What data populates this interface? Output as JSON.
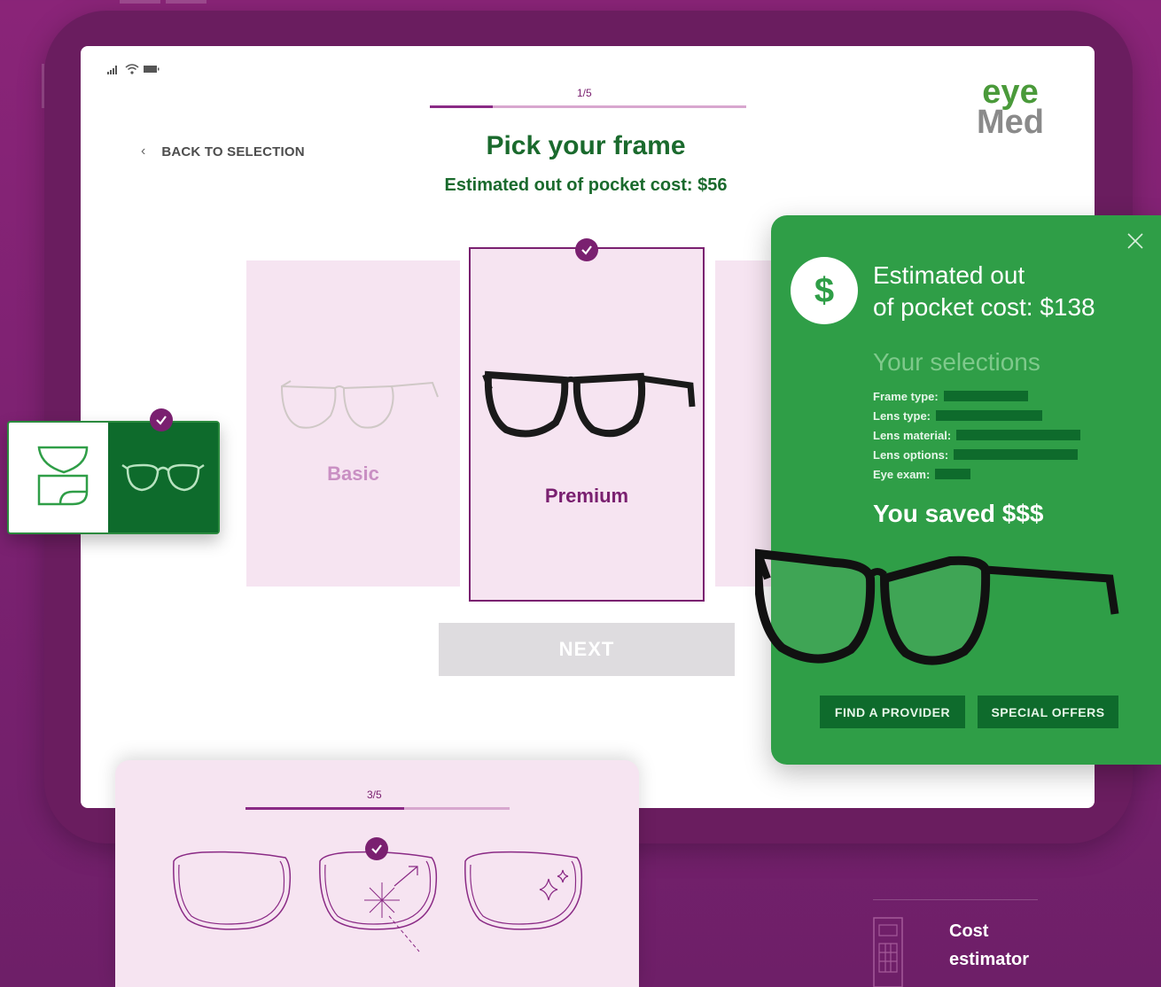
{
  "screen": {
    "progress": {
      "label": "1/5",
      "fraction": 0.2
    },
    "logo": {
      "line1": "eye",
      "line2": "Med"
    },
    "back_label": "BACK TO SELECTION",
    "title": "Pick your frame",
    "subtitle": "Estimated out of pocket cost: $56",
    "frames": [
      {
        "label": "Basic",
        "selected": false
      },
      {
        "label": "Premium",
        "selected": true
      }
    ],
    "next_label": "NEXT"
  },
  "cost_panel": {
    "heading_line1": "Estimated out",
    "heading_line2": "of pocket cost: $138",
    "currency_symbol": "$",
    "selections_title": "Your selections",
    "selections": [
      {
        "label": "Frame type:"
      },
      {
        "label": "Lens type:"
      },
      {
        "label": "Lens material:"
      },
      {
        "label": "Lens options:"
      },
      {
        "label": "Eye exam:"
      }
    ],
    "saved_text": "You saved $$$",
    "find_provider_label": "FIND A PROVIDER",
    "special_offers_label": "SPECIAL OFFERS"
  },
  "lens_card": {
    "progress": {
      "label": "3/5",
      "fraction": 0.6
    }
  },
  "estimator": {
    "label_line1": "Cost",
    "label_line2": "estimator"
  },
  "colors": {
    "background": "#7a2170",
    "brand_green": "#1a6a2d",
    "panel_green": "#2f9e47",
    "dark_green": "#0e6b2c",
    "purple": "#7a2070",
    "card_pink": "#f6e4f1"
  }
}
